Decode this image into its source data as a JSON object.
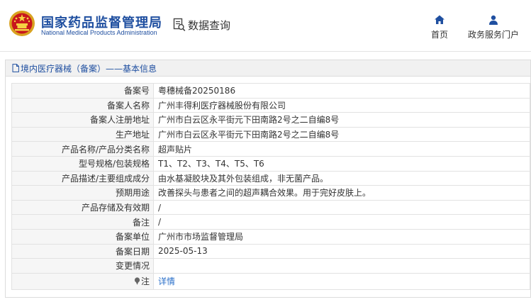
{
  "header": {
    "brand_cn": "国家药品监督管理局",
    "brand_en": "National Medical Products Administration",
    "query_label": "数据查询",
    "nav": [
      {
        "label": "首页",
        "icon": "home-icon"
      },
      {
        "label": "政务服务门户",
        "icon": "user-icon"
      }
    ],
    "brand_color": "#1f4fa0"
  },
  "panel": {
    "title": "境内医疗器械（备案）——基本信息"
  },
  "table": {
    "rows": [
      {
        "label": "备案号",
        "value": "粤穗械备20250186"
      },
      {
        "label": "备案人名称",
        "value": "广州丰得利医疗器械股份有限公司"
      },
      {
        "label": "备案人注册地址",
        "value": "广州市白云区永平街元下田南路2号之二自编8号"
      },
      {
        "label": "生产地址",
        "value": "广州市白云区永平街元下田南路2号之二自编8号"
      },
      {
        "label": "产品名称/产品分类名称",
        "value": "超声贴片"
      },
      {
        "label": "型号规格/包装规格",
        "value": "T1、T2、T3、T4、T5、T6"
      },
      {
        "label": "产品描述/主要组成成分",
        "value": "由水基凝胶块及其外包装组成，非无菌产品。"
      },
      {
        "label": "预期用途",
        "value": "改善探头与患者之间的超声耦合效果。用于完好皮肤上。"
      },
      {
        "label": "产品存储及有效期",
        "value": "/"
      },
      {
        "label": "备注",
        "value": "/"
      },
      {
        "label": "备案单位",
        "value": "广州市市场监督管理局"
      },
      {
        "label": "备案日期",
        "value": "2025-05-13"
      },
      {
        "label": "变更情况",
        "value": ""
      }
    ],
    "note_label": "注",
    "detail_link": "详情",
    "link_color": "#2a6fc9"
  }
}
